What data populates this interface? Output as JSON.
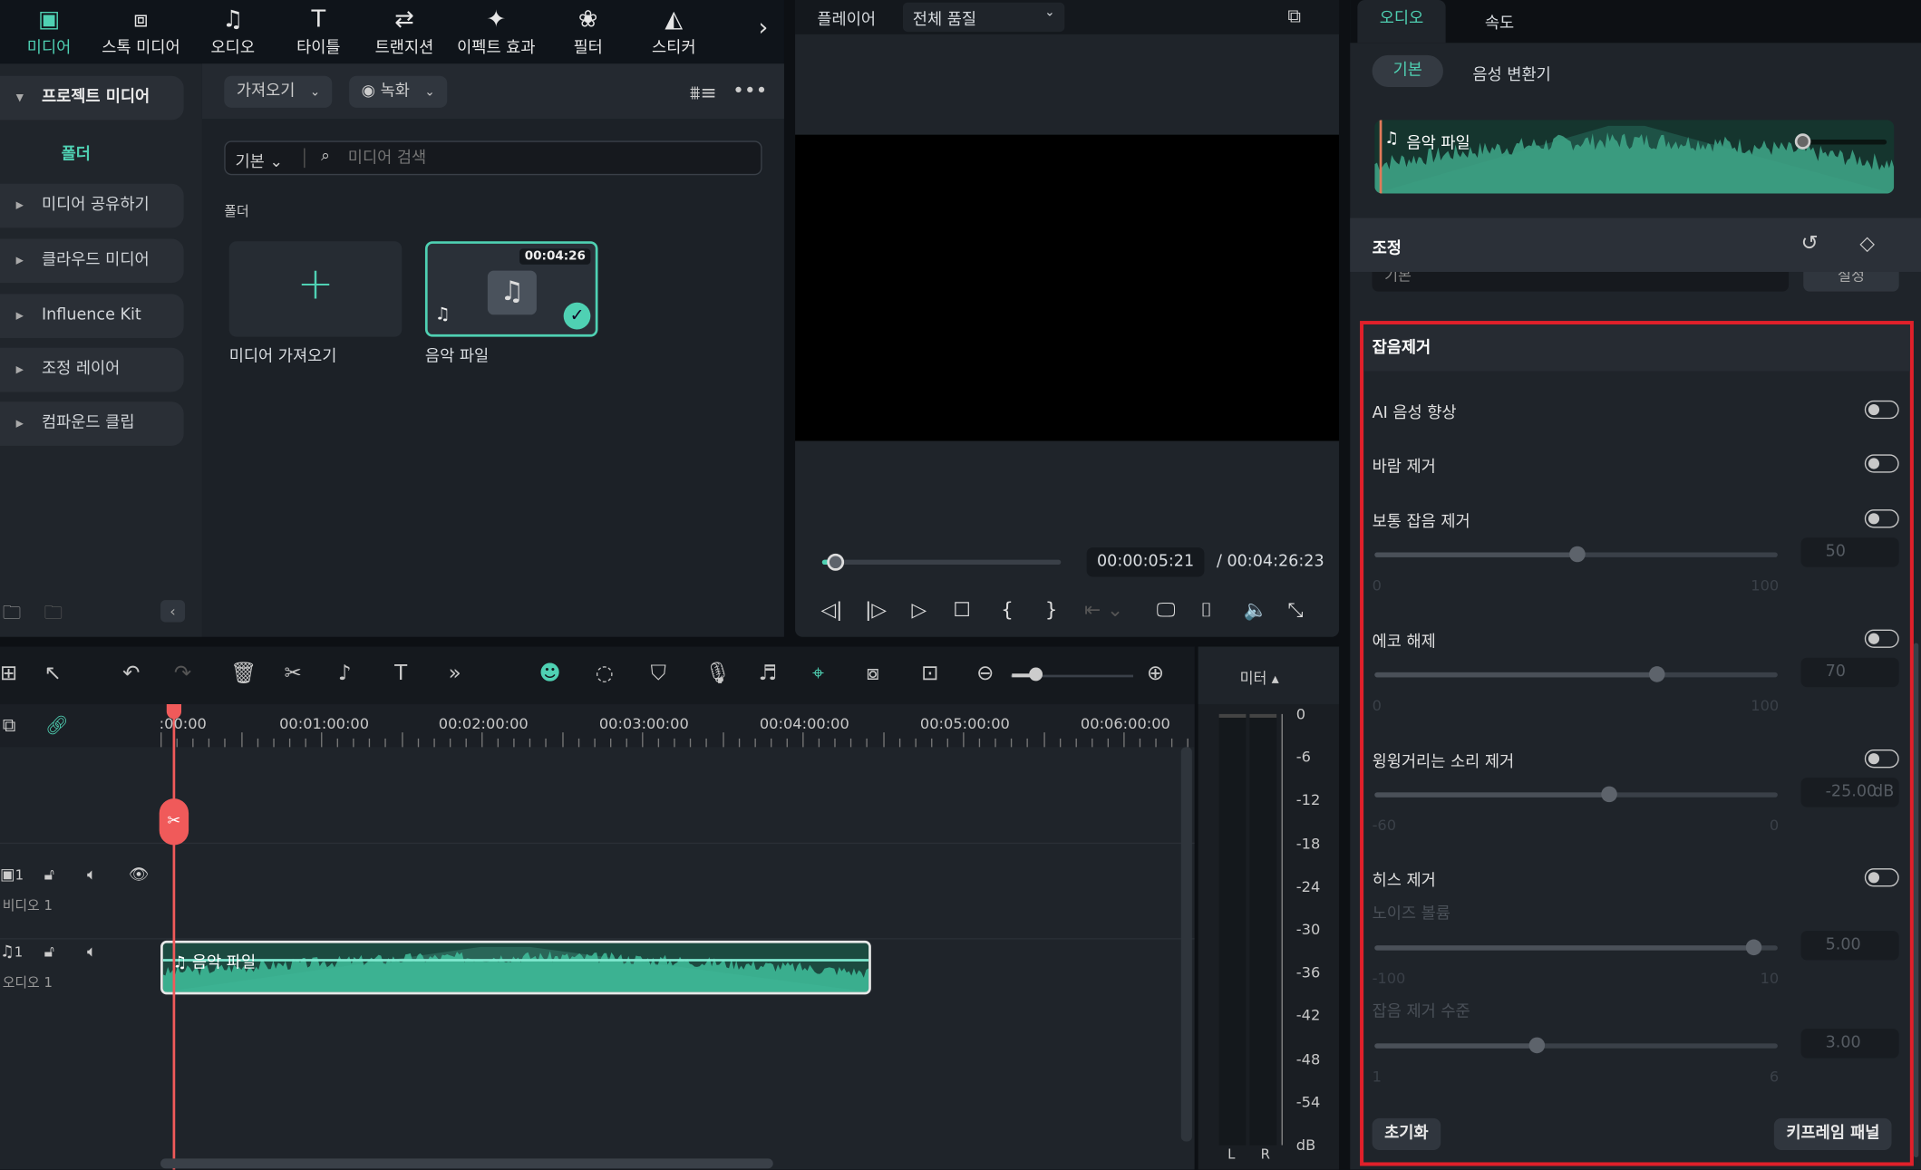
{
  "toolbar": {
    "tabs": [
      {
        "label": "미디어",
        "icon": "media-icon",
        "active": true
      },
      {
        "label": "스톡 미디어",
        "icon": "stock-media-icon"
      },
      {
        "label": "오디오",
        "icon": "music-note-icon"
      },
      {
        "label": "타이틀",
        "icon": "title-t-icon"
      },
      {
        "label": "트랜지션",
        "icon": "transition-icon"
      },
      {
        "label": "이펙트 효과",
        "icon": "effects-star-icon"
      },
      {
        "label": "필터",
        "icon": "filter-icon"
      },
      {
        "label": "스티커",
        "icon": "sticker-icon"
      }
    ],
    "more": "›"
  },
  "sidebar": {
    "items": [
      {
        "label": "프로젝트 미디어",
        "expanded": true
      },
      {
        "label": "미디어 공유하기"
      },
      {
        "label": "클라우드 미디어"
      },
      {
        "label": "Influence Kit"
      },
      {
        "label": "조정 레이어"
      },
      {
        "label": "컴파운드 클립"
      }
    ],
    "folder": "폴더"
  },
  "media": {
    "import": "가져오기",
    "record": "녹화",
    "view": "기본",
    "search_placeholder": "미디어 검색",
    "section": "폴더",
    "cards": [
      {
        "label": "미디어 가져오기"
      },
      {
        "label": "음악 파일",
        "duration": "00:04:26",
        "selected": true
      }
    ]
  },
  "player": {
    "title": "플레이어",
    "quality": "전체 품질",
    "current": "00:00:05:21",
    "total": "/  00:04:26:23",
    "progress": 0.02
  },
  "right": {
    "tabs": [
      "오디오",
      "속도"
    ],
    "subtabs": [
      "기본",
      "음성 변환기"
    ],
    "clip": "음악 파일",
    "adjust": "조정",
    "preset": "기본",
    "settings": "설정",
    "denoise_title": "잡음제거",
    "rows": [
      {
        "label": "AI 음성 향상",
        "on": false
      },
      {
        "label": "바람 제거",
        "on": false
      },
      {
        "label": "보통 잡음 제거",
        "on": false,
        "value": "50",
        "min": "0",
        "max": "100",
        "fraction": 0.5
      },
      {
        "label": "에코 해제",
        "on": false,
        "value": "70",
        "min": "0",
        "max": "100",
        "fraction": 0.7
      },
      {
        "label": "윙윙거리는 소리 제거",
        "on": false,
        "value": "-25.00",
        "unit": "dB",
        "min": "-60",
        "max": "0",
        "fraction": 0.58
      },
      {
        "label": "히스 제거",
        "on": false
      }
    ],
    "hiss": [
      {
        "label": "노이즈 볼륨",
        "value": "5.00",
        "min": "-100",
        "max": "10",
        "fraction": 0.94
      },
      {
        "label": "잡음 제거 수준",
        "value": "3.00",
        "min": "1",
        "max": "6",
        "fraction": 0.4
      }
    ],
    "reset": "초기화",
    "keyframe": "키프레임 패널",
    "highlight_color": "#e0202a"
  },
  "timeline": {
    "ruler": [
      ":00:00",
      "00:01:00:00",
      "00:02:00:00",
      "00:03:00:00",
      "00:04:00:00",
      "00:05:00:00",
      "00:06:00:00"
    ],
    "tracks": [
      {
        "label": "비디오 1",
        "num": "1"
      },
      {
        "label": "오디오 1",
        "num": "1"
      }
    ],
    "clip": "음악 파일",
    "meter_label": "미터 ▴",
    "meter_ticks": [
      "0",
      "-6",
      "-12",
      "-18",
      "-24",
      "-30",
      "-36",
      "-42",
      "-48",
      "-54",
      "dB"
    ],
    "lr": [
      "L",
      "R"
    ]
  },
  "colors": {
    "accent": "#4fd1b3",
    "playhead": "#f05a5a"
  }
}
